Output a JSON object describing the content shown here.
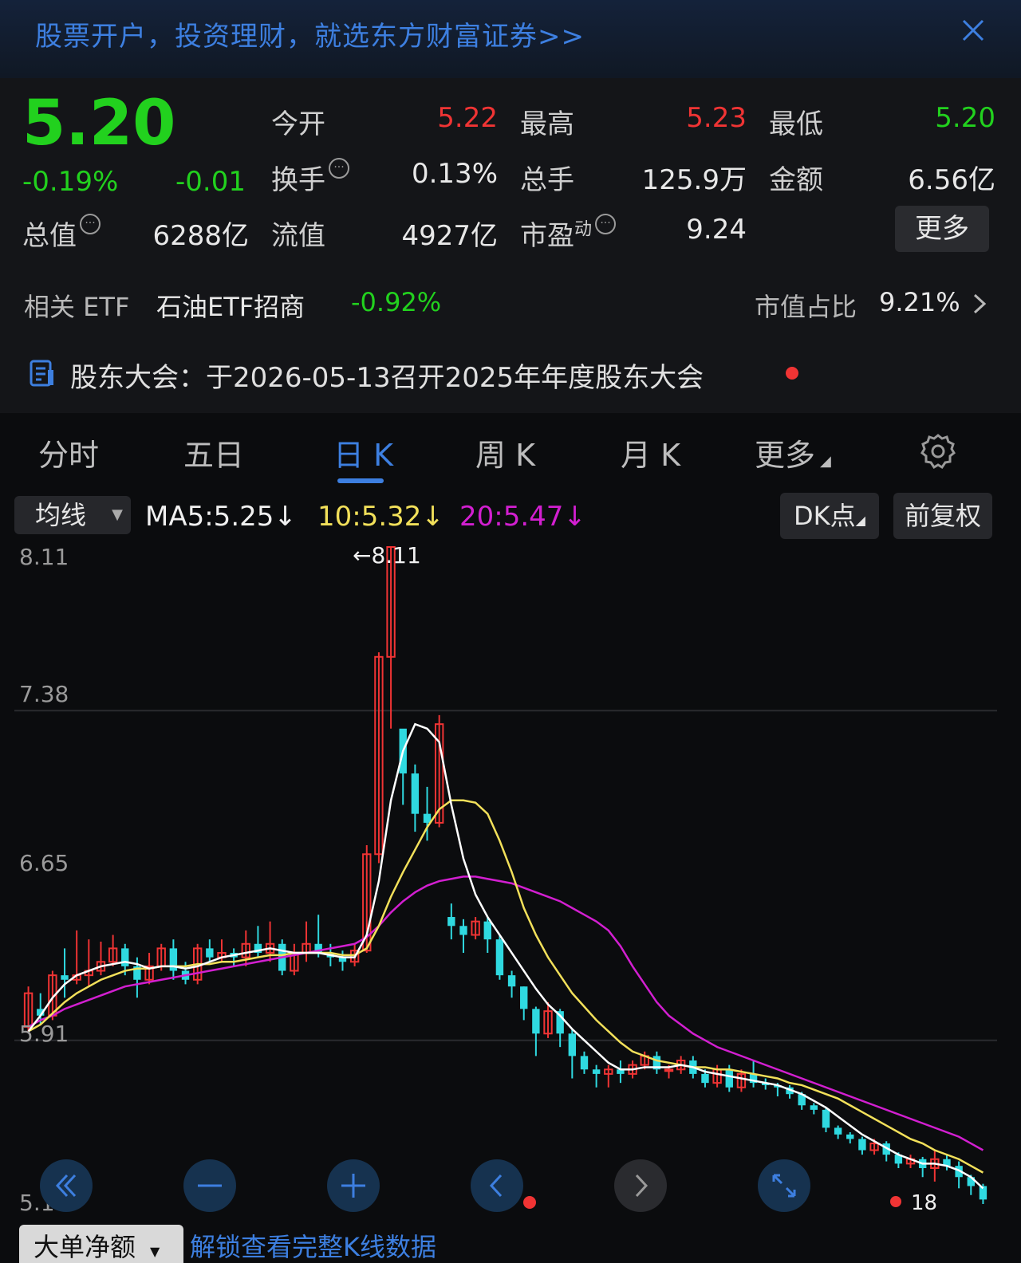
{
  "banner": {
    "text": "股票开户，投资理财，就选东方财富证券>>"
  },
  "quote": {
    "price": "5.20",
    "pct_change": "-0.19%",
    "change": "-0.01",
    "open_label": "今开",
    "open": "5.22",
    "high_label": "最高",
    "high": "5.23",
    "low_label": "最低",
    "low": "5.20",
    "turnover_label": "换手",
    "turnover": "0.13%",
    "volume_label": "总手",
    "volume": "125.9万",
    "amount_label": "金额",
    "amount": "6.56亿",
    "mktcap_label": "总值",
    "mktcap": "6288亿",
    "float_label": "流值",
    "float": "4927亿",
    "pe_label": "市盈",
    "pe_sup": "动",
    "pe": "9.24",
    "more_label": "更多"
  },
  "etf": {
    "label": "相关 ETF",
    "name": "石油ETF招商",
    "change": "-0.92%",
    "weight_label": "市值占比",
    "weight": "9.21%"
  },
  "notice": {
    "text": "股东大会：于2026-05-13召开2025年年度股东大会"
  },
  "tabs": [
    {
      "label": "分时"
    },
    {
      "label": "五日"
    },
    {
      "label": "日 K"
    },
    {
      "label": "周 K"
    },
    {
      "label": "月 K"
    },
    {
      "label": "更多"
    }
  ],
  "toolbar": {
    "indicator": "均线",
    "ma5": "MA5:5.25↓",
    "ma10": "10:5.32↓",
    "ma20": "20:5.47↓",
    "dk_label": "DK点",
    "adjust_label": "前复权"
  },
  "axis": {
    "y1": "8.11",
    "y2": "7.38",
    "y3": "6.65",
    "y4": "5.91",
    "y5": "5.18"
  },
  "chart_annotations": {
    "max_label": "←8.11",
    "min_label": "18"
  },
  "bottom": {
    "indicator": "大单净额",
    "link": "解锁查看完整K线数据"
  },
  "colors": {
    "up": "#f03434",
    "down": "#2fd9e0",
    "ma5": "#ffffff",
    "ma10": "#f2e05a",
    "ma20": "#d21fd0",
    "accent": "#3d7fe0"
  },
  "chart_data": {
    "type": "candlestick",
    "ylim": [
      5.18,
      8.11
    ],
    "candles": [
      [
        5.97,
        6.12,
        5.95,
        6.15
      ],
      [
        6.05,
        6.02,
        5.98,
        6.12
      ],
      [
        6.02,
        6.2,
        6.0,
        6.22
      ],
      [
        6.2,
        6.18,
        6.1,
        6.32
      ],
      [
        6.18,
        6.2,
        6.16,
        6.4
      ],
      [
        6.2,
        6.22,
        6.15,
        6.36
      ],
      [
        6.22,
        6.26,
        6.2,
        6.35
      ],
      [
        6.26,
        6.32,
        6.24,
        6.38
      ],
      [
        6.32,
        6.24,
        6.2,
        6.34
      ],
      [
        6.24,
        6.18,
        6.1,
        6.28
      ],
      [
        6.18,
        6.24,
        6.16,
        6.3
      ],
      [
        6.24,
        6.32,
        6.22,
        6.34
      ],
      [
        6.32,
        6.22,
        6.18,
        6.36
      ],
      [
        6.22,
        6.18,
        6.16,
        6.26
      ],
      [
        6.18,
        6.32,
        6.16,
        6.34
      ],
      [
        6.32,
        6.28,
        6.26,
        6.36
      ],
      [
        6.28,
        6.3,
        6.26,
        6.36
      ],
      [
        6.3,
        6.28,
        6.24,
        6.32
      ],
      [
        6.28,
        6.34,
        6.24,
        6.4
      ],
      [
        6.34,
        6.3,
        6.28,
        6.42
      ],
      [
        6.3,
        6.34,
        6.26,
        6.44
      ],
      [
        6.34,
        6.22,
        6.2,
        6.36
      ],
      [
        6.22,
        6.3,
        6.2,
        6.34
      ],
      [
        6.3,
        6.34,
        6.26,
        6.44
      ],
      [
        6.34,
        6.3,
        6.28,
        6.47
      ],
      [
        6.3,
        6.28,
        6.24,
        6.34
      ],
      [
        6.28,
        6.26,
        6.22,
        6.31
      ],
      [
        6.26,
        6.31,
        6.24,
        6.34
      ],
      [
        6.31,
        6.74,
        6.3,
        6.78
      ],
      [
        6.74,
        7.62,
        6.7,
        7.64
      ],
      [
        7.62,
        8.11,
        7.3,
        8.11
      ],
      [
        7.3,
        7.1,
        6.96,
        7.28
      ],
      [
        7.1,
        6.92,
        6.84,
        7.14
      ],
      [
        6.92,
        6.88,
        6.8,
        7.04
      ],
      [
        6.88,
        7.32,
        6.86,
        7.36
      ],
      [
        6.46,
        6.42,
        6.36,
        6.52
      ],
      [
        6.42,
        6.38,
        6.3,
        6.45
      ],
      [
        6.38,
        6.44,
        6.36,
        6.46
      ],
      [
        6.44,
        6.36,
        6.3,
        6.46
      ],
      [
        6.36,
        6.2,
        6.18,
        6.38
      ],
      [
        6.2,
        6.15,
        6.1,
        6.22
      ],
      [
        6.15,
        6.05,
        6.0,
        6.15
      ],
      [
        6.05,
        5.94,
        5.84,
        6.06
      ],
      [
        5.94,
        6.04,
        5.92,
        6.08
      ],
      [
        6.04,
        5.94,
        5.88,
        6.05
      ],
      [
        5.94,
        5.84,
        5.74,
        5.96
      ],
      [
        5.84,
        5.78,
        5.76,
        5.86
      ],
      [
        5.78,
        5.76,
        5.7,
        5.8
      ],
      [
        5.76,
        5.78,
        5.7,
        5.8
      ],
      [
        5.78,
        5.76,
        5.72,
        5.82
      ],
      [
        5.76,
        5.8,
        5.74,
        5.82
      ],
      [
        5.8,
        5.84,
        5.78,
        5.86
      ],
      [
        5.84,
        5.78,
        5.76,
        5.86
      ],
      [
        5.78,
        5.78,
        5.74,
        5.8
      ],
      [
        5.78,
        5.82,
        5.76,
        5.84
      ],
      [
        5.82,
        5.76,
        5.74,
        5.84
      ],
      [
        5.76,
        5.72,
        5.7,
        5.78
      ],
      [
        5.72,
        5.78,
        5.7,
        5.8
      ],
      [
        5.78,
        5.7,
        5.68,
        5.8
      ],
      [
        5.7,
        5.76,
        5.68,
        5.78
      ],
      [
        5.76,
        5.72,
        5.7,
        5.82
      ],
      [
        5.72,
        5.71,
        5.69,
        5.74
      ],
      [
        5.71,
        5.7,
        5.66,
        5.72
      ],
      [
        5.7,
        5.67,
        5.65,
        5.71
      ],
      [
        5.67,
        5.62,
        5.6,
        5.68
      ],
      [
        5.62,
        5.6,
        5.58,
        5.63
      ],
      [
        5.6,
        5.52,
        5.5,
        5.61
      ],
      [
        5.52,
        5.49,
        5.47,
        5.53
      ],
      [
        5.49,
        5.47,
        5.45,
        5.5
      ],
      [
        5.47,
        5.42,
        5.4,
        5.48
      ],
      [
        5.42,
        5.45,
        5.4,
        5.47
      ],
      [
        5.45,
        5.4,
        5.37,
        5.46
      ],
      [
        5.4,
        5.36,
        5.34,
        5.41
      ],
      [
        5.36,
        5.38,
        5.34,
        5.4
      ],
      [
        5.38,
        5.34,
        5.3,
        5.39
      ],
      [
        5.34,
        5.38,
        5.28,
        5.42
      ],
      [
        5.38,
        5.35,
        5.33,
        5.4
      ],
      [
        5.35,
        5.3,
        5.25,
        5.37
      ],
      [
        5.3,
        5.26,
        5.22,
        5.31
      ],
      [
        5.26,
        5.2,
        5.18,
        5.27
      ]
    ],
    "ma5": [
      5.95,
      6.02,
      6.1,
      6.16,
      6.2,
      6.22,
      6.24,
      6.25,
      6.26,
      6.25,
      6.23,
      6.24,
      6.24,
      6.23,
      6.24,
      6.26,
      6.28,
      6.29,
      6.3,
      6.31,
      6.32,
      6.31,
      6.3,
      6.3,
      6.3,
      6.29,
      6.28,
      6.28,
      6.38,
      6.62,
      6.98,
      7.2,
      7.32,
      7.3,
      7.24,
      6.96,
      6.72,
      6.56,
      6.46,
      6.38,
      6.3,
      6.22,
      6.14,
      6.07,
      6.02,
      5.96,
      5.91,
      5.86,
      5.81,
      5.78,
      5.78,
      5.79,
      5.79,
      5.79,
      5.8,
      5.79,
      5.77,
      5.76,
      5.75,
      5.74,
      5.73,
      5.72,
      5.71,
      5.69,
      5.67,
      5.64,
      5.61,
      5.57,
      5.53,
      5.49,
      5.46,
      5.43,
      5.4,
      5.38,
      5.36,
      5.36,
      5.35,
      5.33,
      5.3,
      5.25
    ],
    "ma10": [
      5.95,
      5.98,
      6.03,
      6.08,
      6.12,
      6.15,
      6.18,
      6.2,
      6.22,
      6.23,
      6.23,
      6.24,
      6.24,
      6.24,
      6.25,
      6.25,
      6.26,
      6.26,
      6.27,
      6.28,
      6.29,
      6.29,
      6.3,
      6.3,
      6.3,
      6.3,
      6.29,
      6.29,
      6.32,
      6.42,
      6.55,
      6.66,
      6.76,
      6.86,
      6.94,
      6.98,
      6.98,
      6.97,
      6.92,
      6.8,
      6.66,
      6.5,
      6.38,
      6.28,
      6.2,
      6.12,
      6.06,
      6.0,
      5.95,
      5.9,
      5.86,
      5.84,
      5.82,
      5.81,
      5.8,
      5.79,
      5.79,
      5.78,
      5.78,
      5.77,
      5.76,
      5.75,
      5.74,
      5.72,
      5.71,
      5.69,
      5.67,
      5.65,
      5.62,
      5.59,
      5.56,
      5.53,
      5.5,
      5.47,
      5.45,
      5.42,
      5.4,
      5.38,
      5.35,
      5.32
    ],
    "ma20": [
      5.97,
      6.0,
      6.02,
      6.05,
      6.07,
      6.09,
      6.11,
      6.13,
      6.15,
      6.16,
      6.17,
      6.18,
      6.19,
      6.2,
      6.21,
      6.22,
      6.23,
      6.24,
      6.25,
      6.26,
      6.27,
      6.28,
      6.29,
      6.3,
      6.31,
      6.32,
      6.33,
      6.34,
      6.37,
      6.42,
      6.48,
      6.53,
      6.57,
      6.6,
      6.62,
      6.63,
      6.64,
      6.64,
      6.63,
      6.62,
      6.61,
      6.59,
      6.57,
      6.55,
      6.53,
      6.5,
      6.47,
      6.44,
      6.4,
      6.33,
      6.24,
      6.16,
      6.08,
      6.02,
      5.98,
      5.94,
      5.91,
      5.88,
      5.86,
      5.84,
      5.82,
      5.8,
      5.78,
      5.76,
      5.74,
      5.72,
      5.7,
      5.68,
      5.66,
      5.64,
      5.62,
      5.6,
      5.58,
      5.56,
      5.54,
      5.52,
      5.5,
      5.48,
      5.45,
      5.42
    ]
  }
}
